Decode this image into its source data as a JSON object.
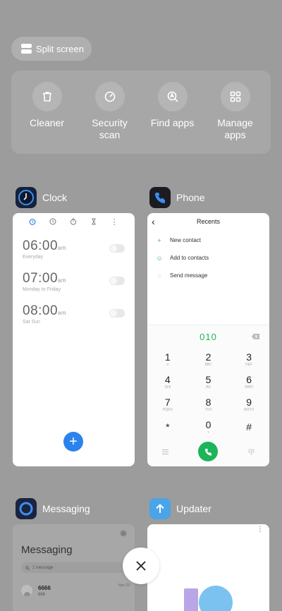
{
  "split_screen": {
    "label": "Split screen"
  },
  "tools": [
    {
      "label": "Cleaner",
      "icon": "trash-icon"
    },
    {
      "label": "Security scan",
      "icon": "security-scan-icon"
    },
    {
      "label": "Find apps",
      "icon": "find-apps-icon"
    },
    {
      "label": "Manage apps",
      "icon": "manage-apps-icon"
    }
  ],
  "apps": {
    "clock": {
      "name": "Clock",
      "alarms": [
        {
          "time": "06:00",
          "ampm": "am",
          "repeat": "Everyday"
        },
        {
          "time": "07:00",
          "ampm": "am",
          "repeat": "Monday to Friday"
        },
        {
          "time": "08:00",
          "ampm": "am",
          "repeat": "Sat Sun"
        }
      ],
      "add_label": "+"
    },
    "phone": {
      "name": "Phone",
      "title": "Recents",
      "back": "‹",
      "actions": [
        "New contact",
        "Add to contacts",
        "Send message"
      ],
      "action_icons": [
        "+",
        "☺",
        "◌"
      ],
      "dialed_number": "010",
      "keys": [
        {
          "n": "1",
          "l": "∞"
        },
        {
          "n": "2",
          "l": "ABC"
        },
        {
          "n": "3",
          "l": "DEF"
        },
        {
          "n": "4",
          "l": "GHI"
        },
        {
          "n": "5",
          "l": "JKL"
        },
        {
          "n": "6",
          "l": "MNO"
        },
        {
          "n": "7",
          "l": "PQRS"
        },
        {
          "n": "8",
          "l": "TUV"
        },
        {
          "n": "9",
          "l": "WXYZ"
        },
        {
          "n": "*",
          "l": ""
        },
        {
          "n": "0",
          "l": "+"
        },
        {
          "n": "#",
          "l": ""
        }
      ]
    },
    "messaging": {
      "name": "Messaging",
      "title": "Messaging",
      "search_placeholder": "1 message",
      "thread": {
        "sender": "6666",
        "preview": "666",
        "date": "Nov 23"
      }
    },
    "updater": {
      "name": "Updater"
    }
  },
  "colors": {
    "background": "#9b9c9b",
    "accent_blue": "#2b83ec",
    "call_green": "#1db45a"
  }
}
